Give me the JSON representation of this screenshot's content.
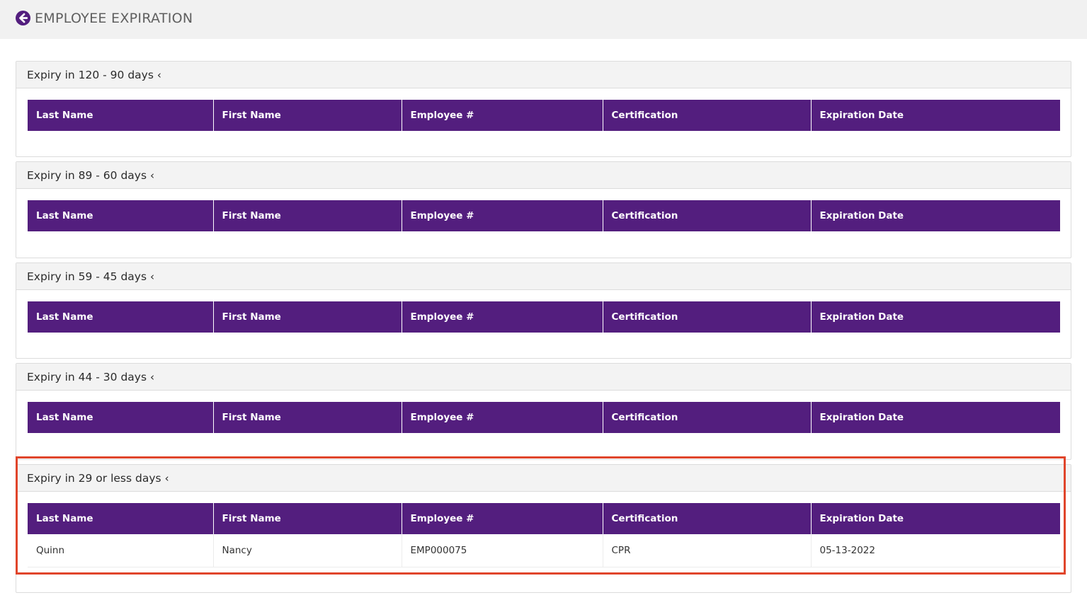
{
  "page": {
    "title": "EMPLOYEE EXPIRATION",
    "back_icon": "arrow-circle-left-icon",
    "accent_color": "#531e7e",
    "highlight_color": "#e0452b"
  },
  "columns": [
    "Last Name",
    "First Name",
    "Employee #",
    "Certification",
    "Expiration Date"
  ],
  "panels": [
    {
      "title": "Expiry in 120 - 90 days",
      "rows": []
    },
    {
      "title": "Expiry in 89 - 60 days",
      "rows": []
    },
    {
      "title": "Expiry in 59 - 45 days",
      "rows": []
    },
    {
      "title": "Expiry in 44 - 30 days",
      "rows": []
    },
    {
      "title": "Expiry in 29 or less days",
      "rows": [
        {
          "last_name": "Quinn",
          "first_name": "Nancy",
          "employee_no": "EMP000075",
          "certification": "CPR",
          "expiration_date": "05-13-2022"
        }
      ]
    }
  ]
}
